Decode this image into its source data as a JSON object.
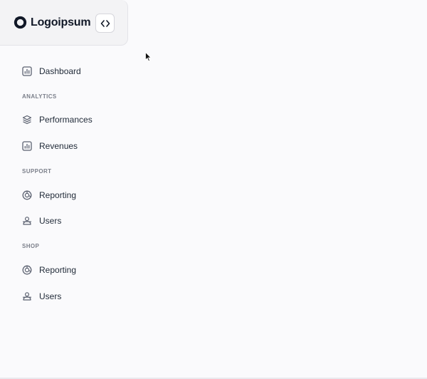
{
  "brand": {
    "logo_text": "Logoipsum",
    "logo_icon": "logo-ring-icon"
  },
  "header": {
    "toggle_icon": "code-brackets-icon"
  },
  "nav": {
    "dashboard": {
      "label": "Dashboard",
      "icon": "bar-chart-icon"
    },
    "sections": [
      {
        "label": "ANALYTICS",
        "items": [
          {
            "label": "Performances",
            "icon": "layers-icon"
          },
          {
            "label": "Revenues",
            "icon": "bar-chart-icon"
          }
        ]
      },
      {
        "label": "SUPPORT",
        "items": [
          {
            "label": "Reporting",
            "icon": "chart-pie-icon"
          },
          {
            "label": "Users",
            "icon": "users-icon"
          }
        ]
      },
      {
        "label": "SHOP",
        "items": [
          {
            "label": "Reporting",
            "icon": "chart-pie-icon"
          },
          {
            "label": "Users",
            "icon": "users-icon"
          }
        ]
      }
    ]
  },
  "colors": {
    "text": "#1f2937",
    "muted": "#7b7f8a",
    "icon": "#5b6170",
    "header_bg": "#f3f3f5",
    "page_bg": "#fafafc"
  }
}
